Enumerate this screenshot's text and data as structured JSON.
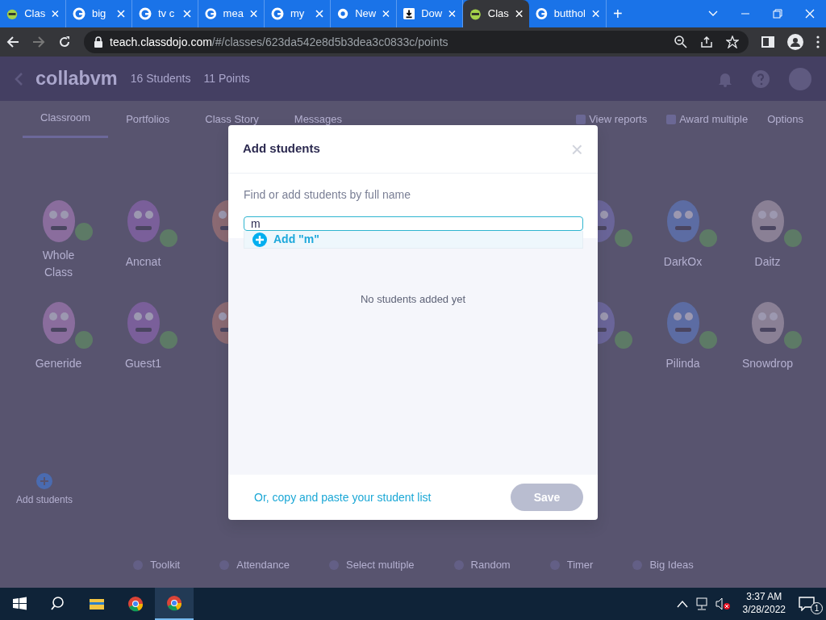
{
  "browser": {
    "tabs": [
      {
        "title": "Clas",
        "kind": "dojo",
        "selected": false
      },
      {
        "title": "big",
        "kind": "google",
        "selected": false
      },
      {
        "title": "tv c",
        "kind": "google",
        "selected": false
      },
      {
        "title": "mea",
        "kind": "google",
        "selected": false
      },
      {
        "title": "my",
        "kind": "google",
        "selected": false
      },
      {
        "title": "New",
        "kind": "chrome",
        "selected": false
      },
      {
        "title": "Dow",
        "kind": "download",
        "selected": false
      },
      {
        "title": "Clas",
        "kind": "dojo",
        "selected": true
      },
      {
        "title": "butthol",
        "kind": "google",
        "selected": false
      }
    ],
    "new_tab": "+",
    "url": {
      "host": "teach.classdojo.com",
      "path": "/#/classes/623da542e8d5b3dea3c0833c/points"
    }
  },
  "header": {
    "class_name": "collabvm",
    "students": "16 Students",
    "points": "11 Points"
  },
  "nav": {
    "tabs": [
      {
        "label": "Classroom",
        "selected": true
      },
      {
        "label": "Portfolios",
        "selected": false
      },
      {
        "label": "Class Story",
        "selected": false
      },
      {
        "label": "Messages",
        "selected": false
      }
    ],
    "actions": [
      "View reports",
      "Award multiple",
      "Options"
    ]
  },
  "students": [
    {
      "kind": "class",
      "name": "Whole Class"
    },
    {
      "kind": "student",
      "name": "Ancnat"
    },
    {
      "kind": "hidden"
    },
    {
      "kind": "hidden"
    },
    {
      "kind": "student",
      "name": "DarkOx"
    },
    {
      "kind": "student",
      "name": "Daitz"
    },
    {
      "kind": "student",
      "name": "Generide"
    },
    {
      "kind": "student",
      "name": "Guest1"
    },
    {
      "kind": "hidden"
    },
    {
      "kind": "hidden"
    },
    {
      "kind": "student",
      "name": "Pilinda"
    },
    {
      "kind": "student",
      "name": "Snowdrop"
    }
  ],
  "add_student": "Add students",
  "toolbar": [
    "Toolkit",
    "Attendance",
    "Select multiple",
    "Random",
    "Timer",
    "Big Ideas"
  ],
  "modal": {
    "title": "Add students",
    "close": "×",
    "label": "Find or add students by full name",
    "value": "m",
    "suggestion": "Add \"m\"",
    "empty": "No students added yet",
    "paste_link": "Or, copy and paste your student list",
    "save": "Save",
    "save_disabled": true
  },
  "taskbar": {
    "time": "3:37 AM",
    "date": "3/28/2022",
    "notifications": "1"
  }
}
